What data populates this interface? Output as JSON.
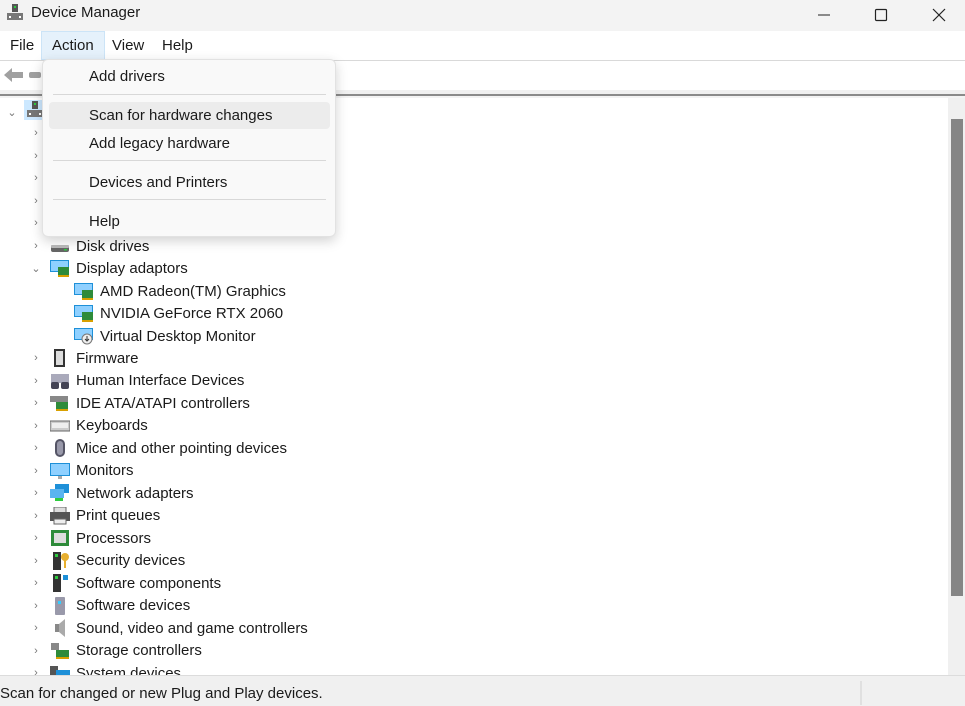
{
  "window": {
    "title": "Device Manager",
    "controls": {
      "minimize": "minimize",
      "maximize": "maximize",
      "close": "close"
    }
  },
  "menubar": {
    "items": [
      {
        "label": "File"
      },
      {
        "label": "Action",
        "active": true
      },
      {
        "label": "View"
      },
      {
        "label": "Help"
      }
    ]
  },
  "action_menu": {
    "items": [
      {
        "label": "Add drivers"
      },
      {
        "label": "Scan for hardware changes",
        "hovered": true
      },
      {
        "label": "Add legacy hardware"
      },
      {
        "label": "Devices and Printers"
      },
      {
        "label": "Help"
      }
    ]
  },
  "tree": {
    "root_expanded": true,
    "items": [
      {
        "label": "Disk drives",
        "expanded": false,
        "icon": "disk-drive-icon"
      },
      {
        "label": "Display adaptors",
        "expanded": true,
        "icon": "display-adapter-icon",
        "children": [
          {
            "label": "AMD Radeon(TM) Graphics",
            "icon": "display-adapter-icon"
          },
          {
            "label": "NVIDIA GeForce RTX 2060",
            "icon": "display-adapter-icon"
          },
          {
            "label": "Virtual Desktop Monitor",
            "icon": "virtual-monitor-icon"
          }
        ]
      },
      {
        "label": "Firmware",
        "expanded": false,
        "icon": "firmware-icon"
      },
      {
        "label": "Human Interface Devices",
        "expanded": false,
        "icon": "hid-icon"
      },
      {
        "label": "IDE ATA/ATAPI controllers",
        "expanded": false,
        "icon": "ide-controller-icon"
      },
      {
        "label": "Keyboards",
        "expanded": false,
        "icon": "keyboard-icon"
      },
      {
        "label": "Mice and other pointing devices",
        "expanded": false,
        "icon": "mouse-icon"
      },
      {
        "label": "Monitors",
        "expanded": false,
        "icon": "monitor-icon"
      },
      {
        "label": "Network adapters",
        "expanded": false,
        "icon": "network-adapter-icon"
      },
      {
        "label": "Print queues",
        "expanded": false,
        "icon": "printer-icon"
      },
      {
        "label": "Processors",
        "expanded": false,
        "icon": "processor-icon"
      },
      {
        "label": "Security devices",
        "expanded": false,
        "icon": "security-device-icon"
      },
      {
        "label": "Software components",
        "expanded": false,
        "icon": "software-component-icon"
      },
      {
        "label": "Software devices",
        "expanded": false,
        "icon": "software-device-icon"
      },
      {
        "label": "Sound, video and game controllers",
        "expanded": false,
        "icon": "speaker-icon"
      },
      {
        "label": "Storage controllers",
        "expanded": false,
        "icon": "storage-controller-icon"
      },
      {
        "label": "System devices",
        "expanded": false,
        "icon": "system-device-icon"
      }
    ]
  },
  "statusbar": {
    "text": "Scan for changed or new Plug and Play devices."
  },
  "colors": {
    "menu_active_bg": "#e5f1fb",
    "selection_bg": "#cce8ff",
    "scroll_thumb": "#858585"
  }
}
